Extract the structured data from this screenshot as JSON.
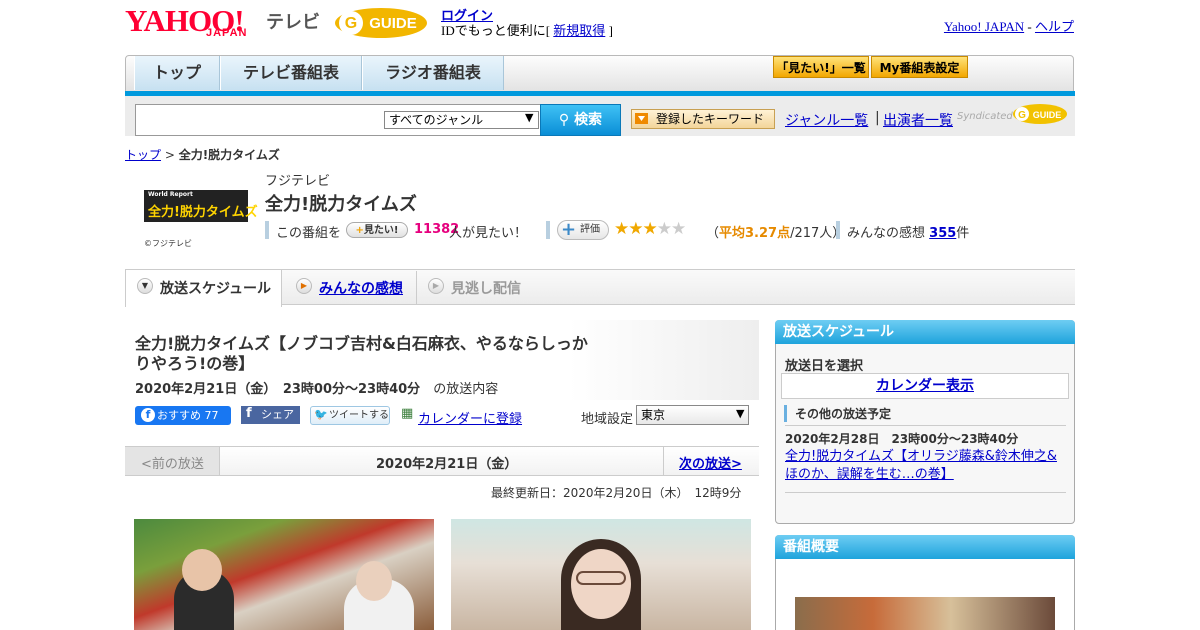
{
  "header": {
    "logo_yahoo": "YAHOO!",
    "logo_japan": "JAPAN",
    "logo_tv": "テレビ",
    "gguide": "GUIDE",
    "login_link": "ログイン",
    "login_msg_prefix": "IDでもっと便利に[ ",
    "register_link": "新規取得",
    "login_msg_suffix": " ]",
    "yahoo_japan_link": "Yahoo! JAPAN",
    "help_sep": " - ",
    "help_link": "ヘルプ"
  },
  "nav": {
    "tabs": [
      "トップ",
      "テレビ番組表",
      "ラジオ番組表"
    ],
    "mitai_list": "「見たい!」一覧",
    "my_schedule": "My番組表設定"
  },
  "search": {
    "genre_selected": "すべてのジャンル",
    "search_button": "検索",
    "keyword_button": "登録したキーワード",
    "genre_list_link": "ジャンル一覧",
    "separator": "|",
    "performer_list_link": "出演者一覧",
    "syndicated": "Syndicated"
  },
  "breadcrumb": {
    "top": "トップ",
    "sep": " > ",
    "current": "全力!脱力タイムズ"
  },
  "program": {
    "logo_small": "World Report",
    "logo_text": "全力!脱力タイムズ",
    "copyright": "©フジテレビ",
    "station": "フジテレビ",
    "title": "全力!脱力タイムズ",
    "want_label": "この番組を",
    "want_button": "見たい!",
    "want_count": "11382",
    "want_tail": "人が見たい！",
    "rate_button": "評価",
    "rating": 3.27,
    "stars_filled": 3,
    "stars_total": 5,
    "avg_open": "（",
    "avg_label": "平均3.27点",
    "avg_tail": "/217人）",
    "impressions_label": "みんなの感想",
    "impressions_count": "355",
    "impressions_unit": "件"
  },
  "subtabs": {
    "schedule": "放送スケジュール",
    "impressions": "みんなの感想",
    "missed": "見逃し配信"
  },
  "episode": {
    "title": "全力!脱力タイムズ【ノブコブ吉村&白石麻衣、やるならしっかりやろう!の巻】",
    "date": "2020年2月21日（金）　23時00分～23時40分",
    "date_tail": "の放送内容",
    "fb_label": "おすすめ",
    "fb_count": "77",
    "share_label": "シェア",
    "tweet_label": "ツイートする",
    "calendar_register": "カレンダーに登録",
    "region_label": "地域設定",
    "region_value": "東京",
    "prev": "<前の放送",
    "current_date": "2020年2月21日（金）",
    "next": "次の放送>",
    "updated": "最終更新日：2020年2月20日（木）　12時9分"
  },
  "sidebar": {
    "schedule_header": "放送スケジュール",
    "select_date": "放送日を選択",
    "calendar_button": "カレンダー表示",
    "other_label": "その他の放送予定",
    "other_date": "2020年2月28日　23時00分～23時40分",
    "other_link": "全力!脱力タイムズ【オリラジ藤森&鈴木伸之&ほのか、誤解を生む…の巻】",
    "overview_header": "番組概要"
  }
}
